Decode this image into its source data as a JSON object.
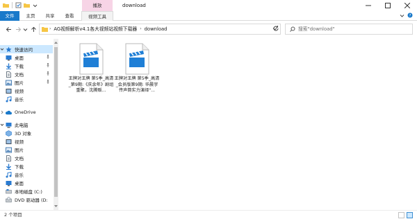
{
  "window": {
    "title": "download",
    "context_tab_top": "播放"
  },
  "ribbon": {
    "tabs": [
      {
        "label": "文件"
      },
      {
        "label": "主页"
      },
      {
        "label": "共享"
      },
      {
        "label": "查看"
      },
      {
        "label": "视频工具"
      }
    ]
  },
  "address": {
    "crumbs": [
      "AG视频解析v4.1各大视频站视频下载器",
      "download"
    ]
  },
  "search": {
    "placeholder": "搜索\"download\""
  },
  "sidebar": {
    "quick_access": "快速访问",
    "quick_items": [
      "桌面",
      "下载",
      "文档",
      "图片",
      "视频",
      "音乐"
    ],
    "onedrive": "OneDrive",
    "this_pc": "此电脑",
    "pc_items": [
      "3D 对象",
      "视频",
      "图片",
      "文档",
      "下载",
      "音乐",
      "桌面",
      "本地磁盘 (C:)",
      "DVD 驱动器 (D:"
    ]
  },
  "files": [
    {
      "name": "王牌对王牌 第5季_高清_第9期:《庆余年》剧组重聚，沈腾贩..."
    },
    {
      "name": "王牌对王牌 第5季_高清_会员版第9期: 华晨宇传声筒实力演绎\"..."
    }
  ],
  "status": {
    "count": "2 个项目"
  },
  "colors": {
    "accent": "#1979ca",
    "context_tab": "#f7d4e6",
    "selection": "#cce8ff",
    "folder": "#f6c645",
    "clapper": "#1f7fd6"
  }
}
